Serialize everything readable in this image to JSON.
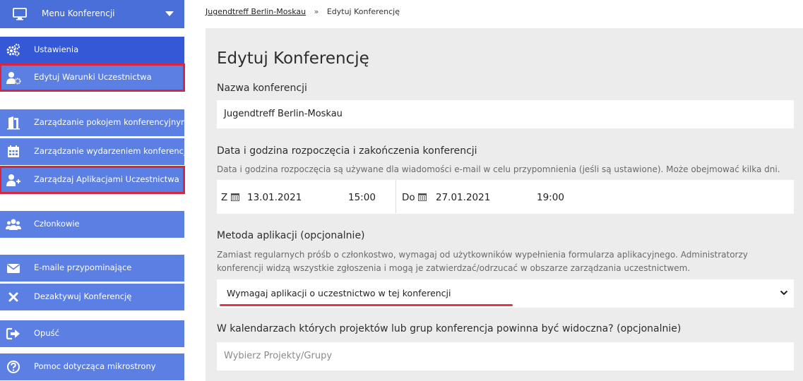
{
  "sidebar": {
    "header_label": "Menu Konferencji",
    "items": [
      {
        "label": "Ustawienia",
        "icon": "gears-icon"
      },
      {
        "label": "Edytuj Warunki Uczestnictwa",
        "icon": "user-settings-icon"
      },
      {
        "label": "Zarządzanie pokojem konferencyjnym",
        "icon": "door-icon"
      },
      {
        "label": "Zarządzanie wydarzeniem konferencji",
        "icon": "calendar-icon"
      },
      {
        "label": "Zarządzaj Aplikacjami Uczestnictwa",
        "icon": "user-plus-icon"
      },
      {
        "label": "Członkowie",
        "icon": "users-icon"
      },
      {
        "label": "E-maile przypominające",
        "icon": "envelope-icon"
      },
      {
        "label": "Dezaktywuj Konferencję",
        "icon": "close-icon"
      },
      {
        "label": "Opuść",
        "icon": "sign-out-icon"
      },
      {
        "label": "Pomoc dotycząca mikrostrony",
        "icon": "help-icon"
      }
    ]
  },
  "breadcrumb": {
    "parent": "Jugendtreff Berlin-Moskau",
    "separator": "»",
    "current": "Edytuj Konferencję"
  },
  "main": {
    "title": "Edytuj Konferencję",
    "name_label": "Nazwa konferencji",
    "name_value": "Jugendtreff Berlin-Moskau",
    "dates_label": "Data i godzina rozpoczęcia i zakończenia konferencji",
    "dates_help": "Data i godzina rozpoczęcia są używane dla wiadomości e-mail w celu przypomnienia (jeśli są ustawione). Może obejmować kilka dni.",
    "start_prefix": "Z",
    "start_date": "13.01.2021",
    "start_time": "15:00",
    "end_prefix": "Do",
    "end_date": "27.01.2021",
    "end_time": "19:00",
    "method_label": "Metoda aplikacji (opcjonalnie)",
    "method_help": "Zamiast regularnych próśb o członkostwo, wymagaj od użytkowników wypełnienia formularza aplikacyjnego. Administratorzy konferencji widzą wszystkie zgłoszenia i mogą je zatwierdzać/odrzucać w obszarze zarządzania uczestnictwem.",
    "method_value": "Wymagaj aplikacji o uczestnictwo w tej konferencji",
    "calendars_label": "W kalendarzach których projektów lub grup konferencja powinna być widoczna? (opcjonalnie)",
    "calendars_placeholder": "Wybierz Projekty/Grupy"
  },
  "colors": {
    "sidebar": "#5b7fe2",
    "sidebar_dark": "#3558d6",
    "highlight": "#d7263d",
    "panel": "#ececec"
  }
}
